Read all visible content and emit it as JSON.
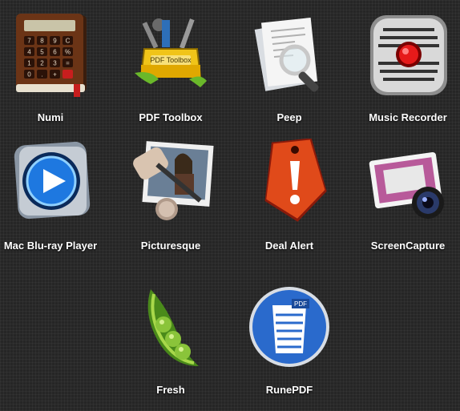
{
  "apps": [
    {
      "name": "Numi",
      "icon": "calculator-book-icon"
    },
    {
      "name": "PDF Toolbox",
      "icon": "toolbox-icon",
      "icon_text": "PDF Toolbox"
    },
    {
      "name": "Peep",
      "icon": "document-magnifier-icon"
    },
    {
      "name": "Music Recorder",
      "icon": "microphone-icon"
    },
    {
      "name": "Mac Blu-ray Player",
      "icon": "play-disc-icon"
    },
    {
      "name": "Picturesque",
      "icon": "photo-brush-icon"
    },
    {
      "name": "Deal Alert",
      "icon": "price-tag-alert-icon"
    },
    {
      "name": "ScreenCapture",
      "icon": "screen-camera-icon"
    },
    {
      "name": "Fresh",
      "icon": "pea-pod-icon"
    },
    {
      "name": "RunePDF",
      "icon": "pdf-trash-icon",
      "icon_text": "PDF"
    }
  ],
  "numi_keys": [
    "7",
    "8",
    "9",
    "C",
    "4",
    "5",
    "6",
    "%",
    "1",
    "2",
    "3",
    "=",
    "0",
    ".",
    "+",
    ""
  ]
}
